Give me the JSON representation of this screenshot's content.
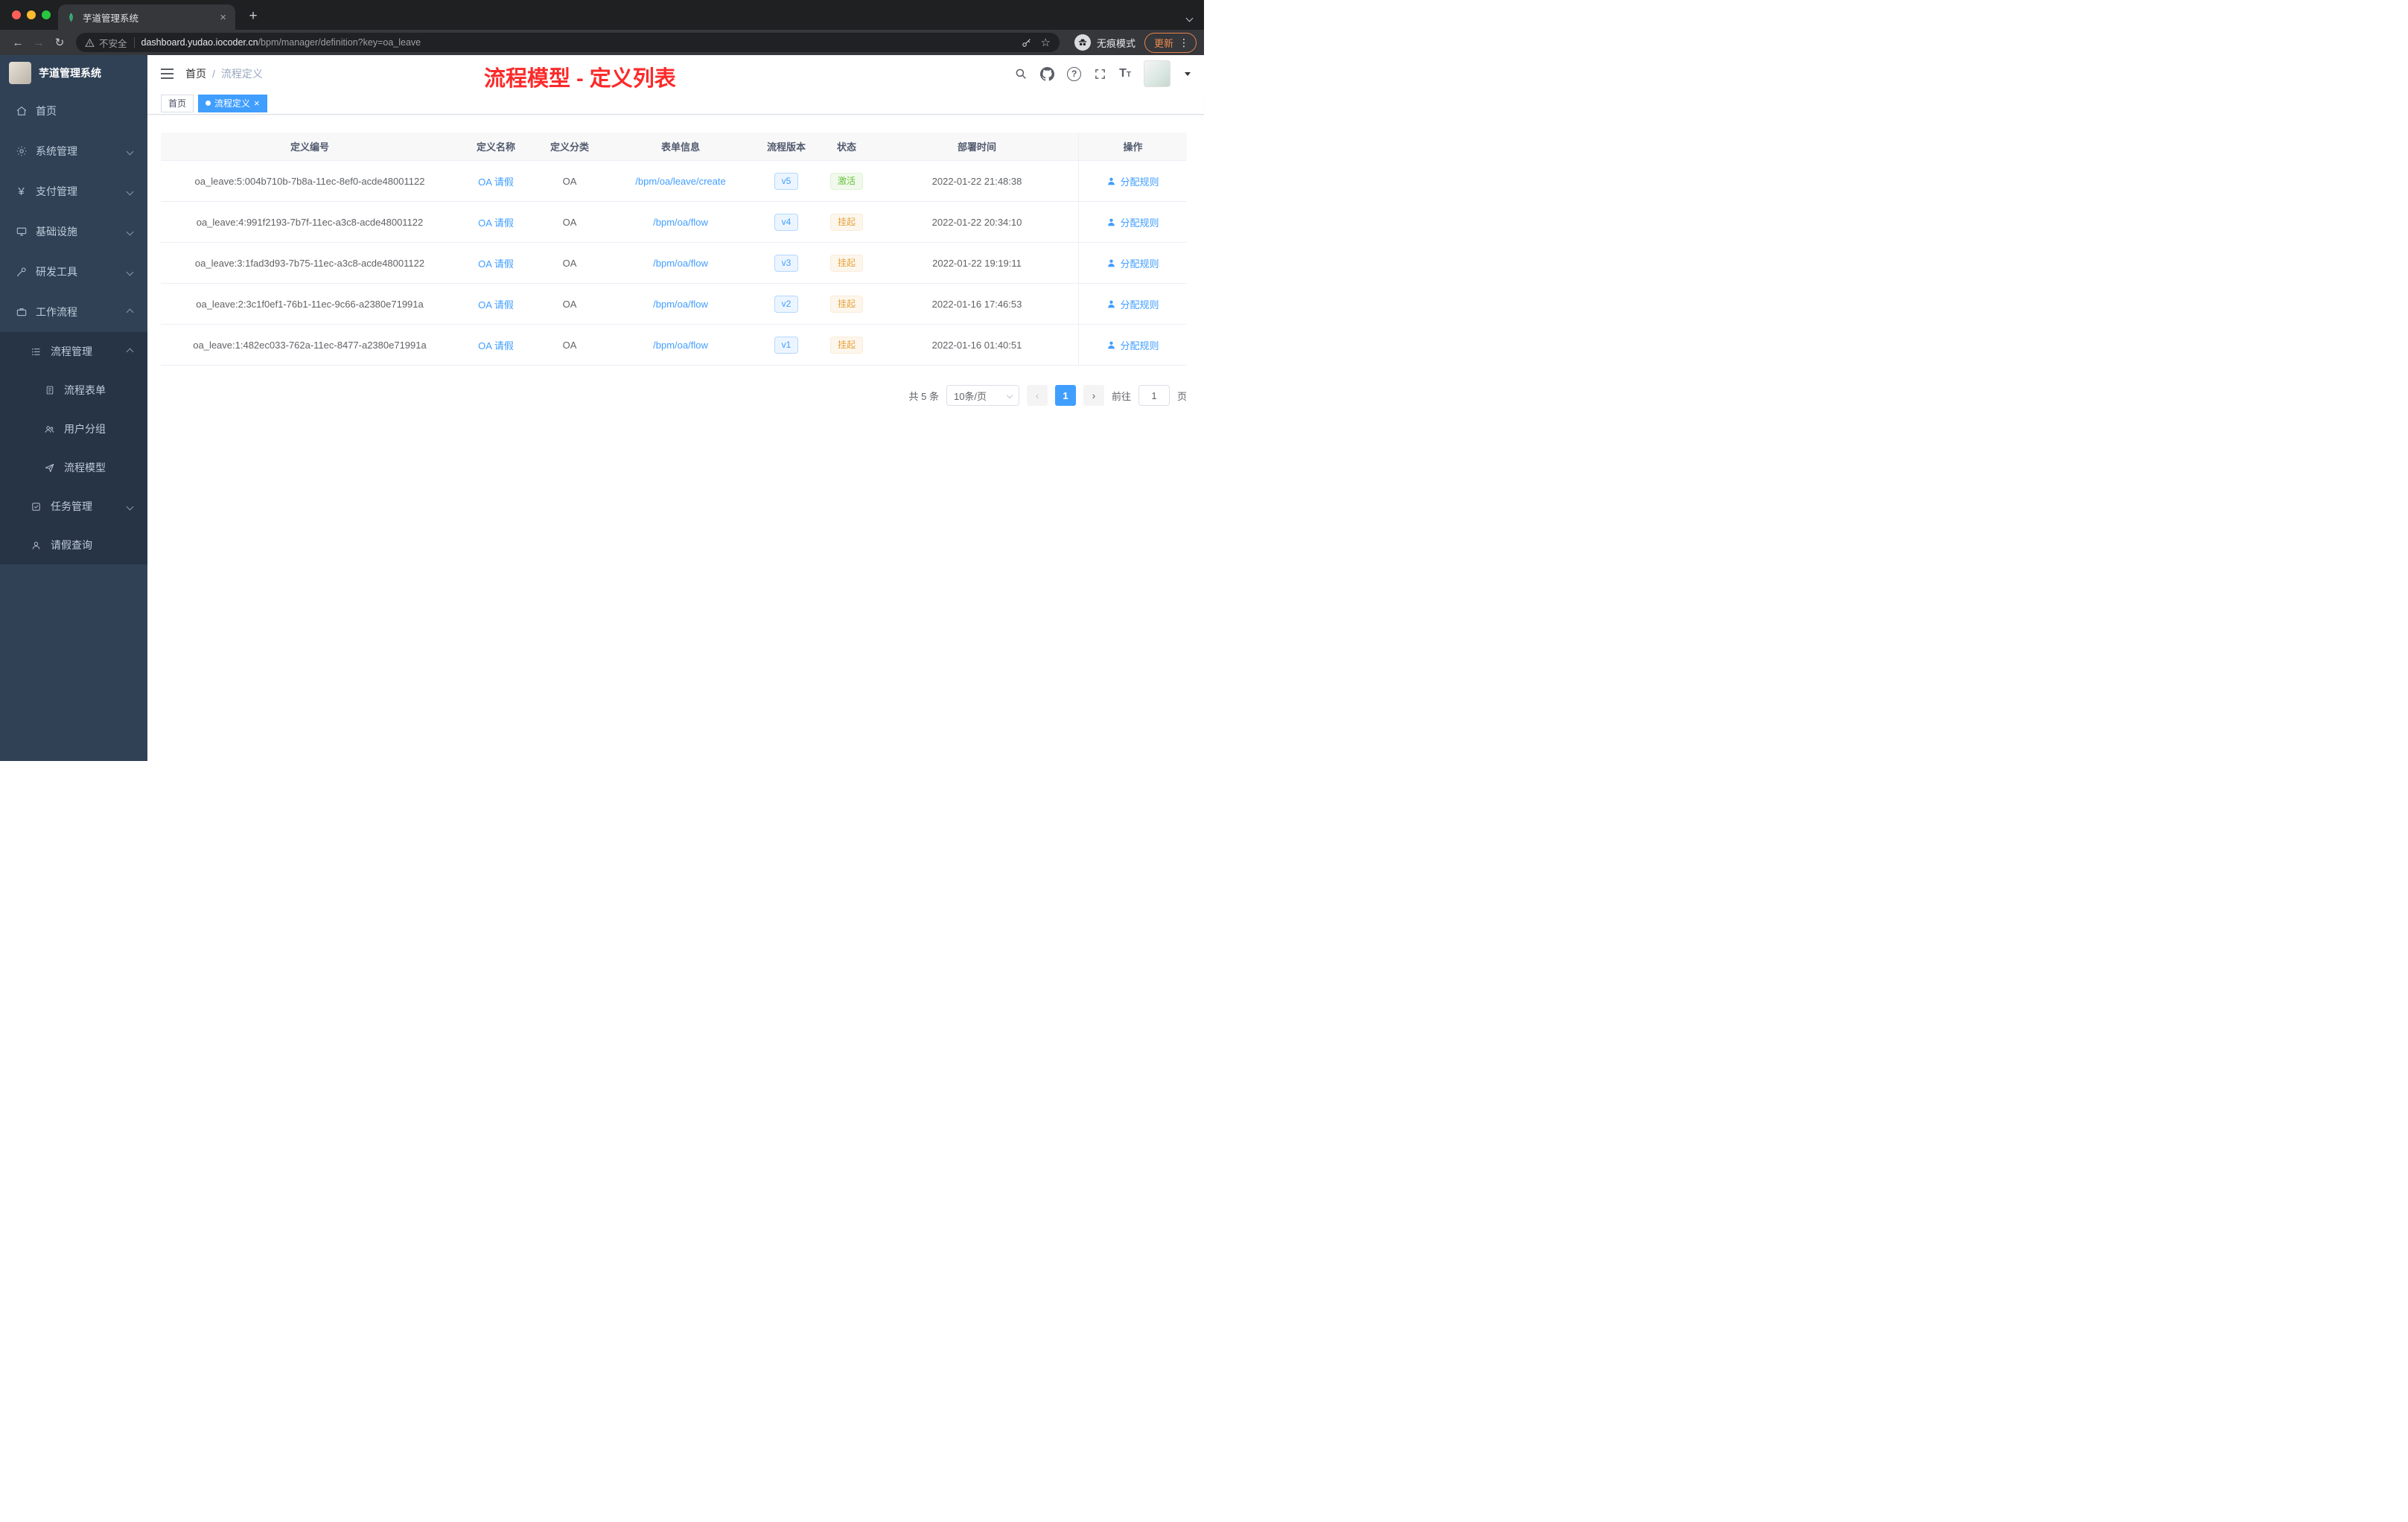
{
  "browser": {
    "tab": {
      "title": "芋道管理系统"
    },
    "address": {
      "security_label": "不安全",
      "host": "dashboard.yudao.iocoder.cn",
      "path": "/bpm/manager/definition?key=oa_leave"
    },
    "incognito_label": "无痕模式",
    "update_label": "更新"
  },
  "sidebar": {
    "title": "芋道管理系统",
    "items": [
      {
        "label": "首页"
      },
      {
        "label": "系统管理"
      },
      {
        "label": "支付管理"
      },
      {
        "label": "基础设施"
      },
      {
        "label": "研发工具"
      },
      {
        "label": "工作流程"
      }
    ],
    "sub": {
      "process_management": "流程管理",
      "process_form": "流程表单",
      "user_group": "用户分组",
      "process_model": "流程模型",
      "task_management": "任务管理",
      "leave_query": "请假查询"
    }
  },
  "header": {
    "breadcrumb_home": "首页",
    "breadcrumb_current": "流程定义",
    "annotation": "流程模型 - 定义列表"
  },
  "tags": {
    "home": "首页",
    "current": "流程定义"
  },
  "table": {
    "headers": [
      "定义编号",
      "定义名称",
      "定义分类",
      "表单信息",
      "流程版本",
      "状态",
      "部署时间",
      "操作"
    ],
    "action_label": "分配规则",
    "rows": [
      {
        "id": "oa_leave:5:004b710b-7b8a-11ec-8ef0-acde48001122",
        "name": "OA 请假",
        "category": "OA",
        "form": "/bpm/oa/leave/create",
        "version": "v5",
        "status": "激活",
        "status_type": "active",
        "time": "2022-01-22 21:48:38"
      },
      {
        "id": "oa_leave:4:991f2193-7b7f-11ec-a3c8-acde48001122",
        "name": "OA 请假",
        "category": "OA",
        "form": "/bpm/oa/flow",
        "version": "v4",
        "status": "挂起",
        "status_type": "suspended",
        "time": "2022-01-22 20:34:10"
      },
      {
        "id": "oa_leave:3:1fad3d93-7b75-11ec-a3c8-acde48001122",
        "name": "OA 请假",
        "category": "OA",
        "form": "/bpm/oa/flow",
        "version": "v3",
        "status": "挂起",
        "status_type": "suspended",
        "time": "2022-01-22 19:19:11"
      },
      {
        "id": "oa_leave:2:3c1f0ef1-76b1-11ec-9c66-a2380e71991a",
        "name": "OA 请假",
        "category": "OA",
        "form": "/bpm/oa/flow",
        "version": "v2",
        "status": "挂起",
        "status_type": "suspended",
        "time": "2022-01-16 17:46:53"
      },
      {
        "id": "oa_leave:1:482ec033-762a-11ec-8477-a2380e71991a",
        "name": "OA 请假",
        "category": "OA",
        "form": "/bpm/oa/flow",
        "version": "v1",
        "status": "挂起",
        "status_type": "suspended",
        "time": "2022-01-16 01:40:51"
      }
    ]
  },
  "pagination": {
    "total": "共 5 条",
    "page_size": "10条/页",
    "page": "1",
    "goto_prefix": "前往",
    "goto_value": "1",
    "goto_suffix": "页"
  },
  "colors": {
    "accent": "#409eff",
    "annotation_red": "#fb2a2a",
    "status_active": "#67c23a",
    "status_suspended": "#e6a23c"
  }
}
